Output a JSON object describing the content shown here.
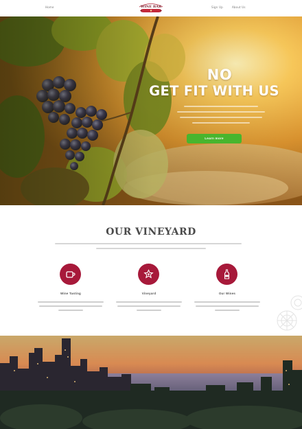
{
  "nav": {
    "left_link": "Home",
    "right_links": [
      "Sign Up",
      "About Us"
    ],
    "logo_text": "WINE BAR"
  },
  "hero": {
    "title_line1": "NO",
    "title_line2": "GET FIT WITH US",
    "cta_label": "Learn more",
    "cta_color": "#48b52e"
  },
  "vineyard": {
    "title": "OUR VINEYARD",
    "accent_color": "#a7193a",
    "features": [
      {
        "icon": "cup-icon",
        "label": "Wine Tasting"
      },
      {
        "icon": "badge-icon",
        "label": "Vineyard"
      },
      {
        "icon": "bottle-icon",
        "label": "Our Wines"
      }
    ]
  }
}
